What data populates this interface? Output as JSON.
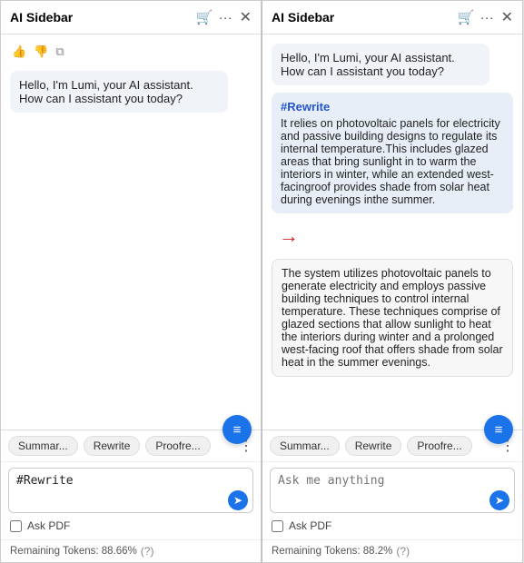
{
  "left": {
    "title": "AI Sidebar",
    "cart_icon": "🛒",
    "more_icon": "···",
    "close_icon": "✕",
    "thumb_up": "👍",
    "thumb_down": "👎",
    "copy_icon": "⧉",
    "lumi_message": "Hello, I'm Lumi, your AI assistant. How can I assistant you today?",
    "fab_icon": "≡",
    "toolbar": {
      "btn1": "Summar...",
      "btn2": "Rewrite",
      "btn3": "Proofre...",
      "more": "⋮"
    },
    "input": {
      "value": "#Rewrite",
      "placeholder": ""
    },
    "pdf_label": "Ask PDF",
    "tokens_text": "Remaining Tokens: 88.66%",
    "help_icon": "?"
  },
  "right": {
    "title": "AI Sidebar",
    "cart_icon": "🛒",
    "more_icon": "···",
    "close_icon": "✕",
    "lumi_message": "Hello, I'm Lumi, your AI assistant. How can I assistant you today?",
    "rewrite_label": "#Rewrite",
    "rewrite_body": "It relies on photovoltaic panels for electricity and passive building designs to regulate its internal temperature.This includes glazed areas that bring sunlight in to warm the interiors in winter, while an extended west-facingroof provides shade from solar heat during evenings inthe summer.",
    "arrow": "→",
    "plain_body": "The system utilizes photovoltaic panels to generate electricity and employs passive building techniques to control internal temperature. These techniques comprise of glazed sections that allow sunlight to heat the interiors during winter and a prolonged west-facing roof that offers shade from solar heat in the summer evenings.",
    "fab_icon": "≡",
    "toolbar": {
      "btn1": "Summar...",
      "btn2": "Rewrite",
      "btn3": "Proofre...",
      "more": "⋮"
    },
    "input": {
      "placeholder": "Ask me anything"
    },
    "pdf_label": "Ask PDF",
    "tokens_text": "Remaining Tokens: 88.2%",
    "help_icon": "?"
  }
}
